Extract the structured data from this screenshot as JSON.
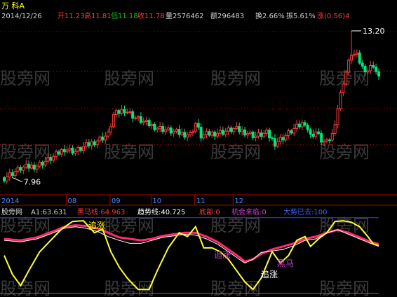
{
  "header": {
    "title": "万 科A",
    "quote": [
      {
        "text": "2014/12/26",
        "color": "#d0d0d0"
      },
      {
        "text": "开11.23",
        "color": "#ff3b3b"
      },
      {
        "text": "高11.81",
        "color": "#ff3b3b"
      },
      {
        "text": "低11.18",
        "color": "#00d000"
      },
      {
        "text": "收11.78",
        "color": "#ff3b3b"
      },
      {
        "text": "量2576462",
        "color": "#d0d0d0"
      },
      {
        "text": "额296483",
        "color": "#d0d0d0"
      },
      {
        "text": "换2.66%",
        "color": "#d0d0d0"
      },
      {
        "text": "振5.61%",
        "color": "#d0d0d0"
      },
      {
        "text": "涨(0.56)4.",
        "color": "#ff3b3b"
      }
    ]
  },
  "indicator_header": [
    {
      "text": "股旁网",
      "color": "#d0d0d0"
    },
    {
      "text": "A1:63.631",
      "color": "#d0d0d0"
    },
    {
      "text": "黑马线:64.963",
      "color": "#ff3b3b"
    },
    {
      "text": "趋势线:40.725",
      "color": "#ffffff"
    },
    {
      "text": "底部:0",
      "color": "#ff3b3b"
    },
    {
      "text": "机会来临:0",
      "color": "#d040d0"
    },
    {
      "text": "大势已去:100",
      "color": "#4060ff"
    }
  ],
  "watermark": "股旁网",
  "colors": {
    "up": "#ff3b3b",
    "down": "#00e676",
    "black_horse": "#ff2a6a",
    "trend": "#ffffff",
    "a1": "#ffff33",
    "grid": "#b00000",
    "blue_level": "#2040ff",
    "magenta_level": "#c040c0",
    "axis": "#b00000"
  },
  "chart_data": [
    {
      "type": "candlestick",
      "title": "万 科A",
      "ylim": [
        7.4,
        13.6
      ],
      "x_labels": [
        "2014",
        "08",
        "09",
        "10",
        "11",
        "12"
      ],
      "annotations": [
        {
          "label": "13.20",
          "value": 13.2,
          "kind": "high"
        },
        {
          "label": "7.96",
          "value": 7.96,
          "kind": "low"
        }
      ],
      "price_path": [
        [
          0,
          7.96
        ],
        [
          6,
          8.3
        ],
        [
          12,
          8.4
        ],
        [
          18,
          8.7
        ],
        [
          22,
          9.0
        ],
        [
          26,
          8.9
        ],
        [
          30,
          9.1
        ],
        [
          34,
          9.3
        ],
        [
          38,
          9.5
        ],
        [
          40,
          10.2
        ],
        [
          44,
          10.4
        ],
        [
          48,
          10.1
        ],
        [
          52,
          9.9
        ],
        [
          56,
          9.75
        ],
        [
          60,
          9.65
        ],
        [
          64,
          9.55
        ],
        [
          68,
          9.5
        ],
        [
          70,
          9.9
        ],
        [
          72,
          9.45
        ],
        [
          76,
          9.55
        ],
        [
          80,
          9.6
        ],
        [
          84,
          9.7
        ],
        [
          88,
          9.6
        ],
        [
          92,
          9.45
        ],
        [
          96,
          9.55
        ],
        [
          99,
          9.2
        ],
        [
          102,
          9.4
        ],
        [
          106,
          9.7
        ],
        [
          110,
          9.95
        ],
        [
          112,
          9.45
        ],
        [
          114,
          9.6
        ],
        [
          116,
          9.3
        ],
        [
          118,
          9.2
        ],
        [
          120,
          9.5
        ],
        [
          124,
          11.4
        ],
        [
          127,
          12.4
        ],
        [
          129,
          12.3
        ],
        [
          131,
          11.9
        ],
        [
          133,
          11.8
        ],
        [
          135,
          12.0
        ],
        [
          137,
          11.5
        ]
      ]
    },
    {
      "type": "line",
      "title": "股旁网",
      "ylim": [
        -5,
        110
      ],
      "levels": [
        {
          "name": "大势已去",
          "value": 100
        },
        {
          "name": "机会来临",
          "value": 0
        }
      ],
      "annotations": [
        "追涨",
        "追涨",
        "黑马",
        "追涨"
      ],
      "series": [
        {
          "name": "A1",
          "path": [
            [
              0,
              50
            ],
            [
              3,
              25
            ],
            [
              6,
              10
            ],
            [
              9,
              30
            ],
            [
              13,
              55
            ],
            [
              17,
              70
            ],
            [
              21,
              85
            ],
            [
              25,
              95
            ],
            [
              29,
              96
            ],
            [
              33,
              80
            ],
            [
              36,
              85
            ],
            [
              39,
              55
            ],
            [
              42,
              35
            ],
            [
              45,
              20
            ],
            [
              49,
              5
            ],
            [
              53,
              5
            ],
            [
              56,
              30
            ],
            [
              60,
              60
            ],
            [
              64,
              80
            ],
            [
              67,
              75
            ],
            [
              70,
              88
            ],
            [
              73,
              60
            ],
            [
              76,
              60
            ],
            [
              79,
              55
            ],
            [
              82,
              45
            ],
            [
              85,
              30
            ],
            [
              88,
              15
            ],
            [
              91,
              5
            ],
            [
              94,
              20
            ],
            [
              98,
              55
            ],
            [
              101,
              40
            ],
            [
              104,
              50
            ],
            [
              107,
              70
            ],
            [
              110,
              75
            ],
            [
              112,
              62
            ],
            [
              115,
              72
            ],
            [
              118,
              80
            ],
            [
              121,
              95
            ],
            [
              124,
              96
            ],
            [
              127,
              94
            ],
            [
              130,
              88
            ],
            [
              133,
              75
            ],
            [
              135,
              65
            ],
            [
              137,
              63
            ]
          ]
        },
        {
          "name": "黑马线",
          "path": [
            [
              0,
              72
            ],
            [
              6,
              70
            ],
            [
              12,
              74
            ],
            [
              18,
              82
            ],
            [
              22,
              88
            ],
            [
              26,
              90
            ],
            [
              30,
              89
            ],
            [
              34,
              86
            ],
            [
              38,
              80
            ],
            [
              42,
              74
            ],
            [
              46,
              72
            ],
            [
              50,
              70
            ],
            [
              54,
              72
            ],
            [
              58,
              76
            ],
            [
              62,
              78
            ],
            [
              66,
              80
            ],
            [
              70,
              80
            ],
            [
              74,
              75
            ],
            [
              78,
              68
            ],
            [
              82,
              58
            ],
            [
              86,
              48
            ],
            [
              88,
              42
            ],
            [
              91,
              45
            ],
            [
              94,
              52
            ],
            [
              98,
              58
            ],
            [
              102,
              62
            ],
            [
              106,
              66
            ],
            [
              110,
              72
            ],
            [
              114,
              75
            ],
            [
              118,
              80
            ],
            [
              122,
              84
            ],
            [
              126,
              80
            ],
            [
              130,
              74
            ],
            [
              134,
              68
            ],
            [
              137,
              65
            ]
          ]
        },
        {
          "name": "趋势线",
          "path": [
            [
              0,
              70
            ],
            [
              6,
              68
            ],
            [
              12,
              72
            ],
            [
              18,
              80
            ],
            [
              22,
              86
            ],
            [
              26,
              88
            ],
            [
              30,
              86
            ],
            [
              34,
              82
            ],
            [
              38,
              75
            ],
            [
              42,
              70
            ],
            [
              46,
              66
            ],
            [
              50,
              66
            ],
            [
              54,
              70
            ],
            [
              58,
              74
            ],
            [
              62,
              76
            ],
            [
              66,
              78
            ],
            [
              70,
              77
            ],
            [
              74,
              72
            ],
            [
              78,
              65
            ],
            [
              82,
              55
            ],
            [
              86,
              45
            ],
            [
              88,
              40
            ],
            [
              91,
              45
            ],
            [
              94,
              54
            ],
            [
              98,
              56
            ],
            [
              102,
              58
            ],
            [
              106,
              63
            ],
            [
              110,
              70
            ],
            [
              114,
              72
            ],
            [
              118,
              80
            ],
            [
              122,
              84
            ],
            [
              126,
              78
            ],
            [
              130,
              72
            ],
            [
              134,
              66
            ],
            [
              137,
              62
            ]
          ]
        }
      ]
    }
  ]
}
